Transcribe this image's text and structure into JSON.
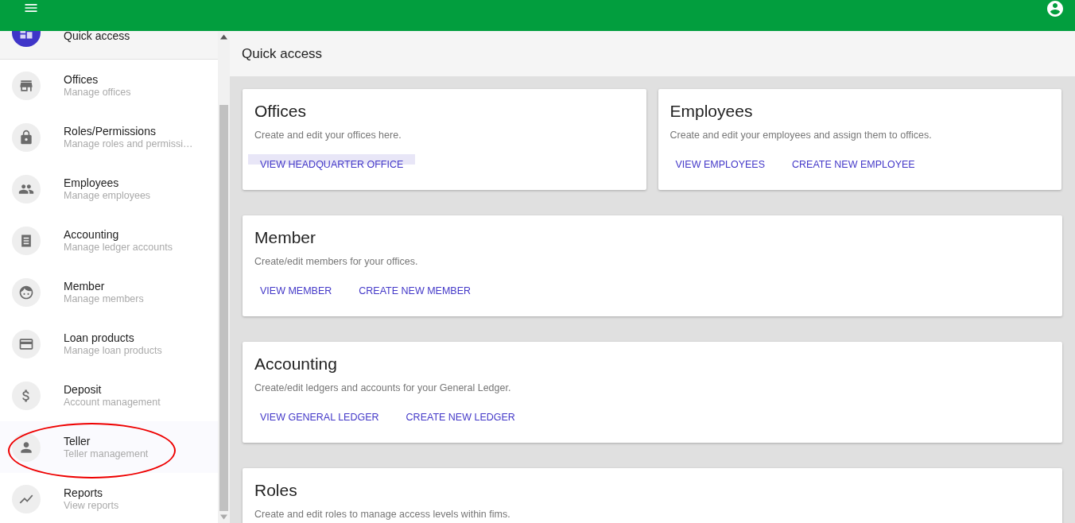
{
  "sidebar": {
    "items": [
      {
        "title": "Quick access",
        "selected": true,
        "circled": false
      },
      {
        "title": "Offices",
        "subtitle": "Manage offices",
        "selected": false,
        "circled": false
      },
      {
        "title": "Roles/Permissions",
        "subtitle": "Manage roles and permissi…",
        "selected": false,
        "circled": false
      },
      {
        "title": "Employees",
        "subtitle": "Manage employees",
        "selected": false,
        "circled": false
      },
      {
        "title": "Accounting",
        "subtitle": "Manage ledger accounts",
        "selected": false,
        "circled": false
      },
      {
        "title": "Member",
        "subtitle": "Manage members",
        "selected": false,
        "circled": false
      },
      {
        "title": "Loan products",
        "subtitle": "Manage loan products",
        "selected": false,
        "circled": false
      },
      {
        "title": "Deposit",
        "subtitle": "Account management",
        "selected": false,
        "circled": false
      },
      {
        "title": "Teller",
        "subtitle": "Teller management",
        "selected": false,
        "circled": true
      },
      {
        "title": "Reports",
        "subtitle": "View reports",
        "selected": false,
        "circled": false
      }
    ]
  },
  "page_title": "Quick access",
  "cards": [
    {
      "title": "Offices",
      "description": "Create and edit your offices here.",
      "actions": [
        {
          "label": "VIEW HEADQUARTER OFFICE",
          "focused": true
        }
      ]
    },
    {
      "title": "Employees",
      "description": "Create and edit your employees and assign them to offices.",
      "actions": [
        {
          "label": "VIEW EMPLOYEES",
          "focused": false
        },
        {
          "label": "CREATE NEW EMPLOYEE",
          "focused": false
        }
      ]
    },
    {
      "title": "Member",
      "description": "Create/edit members for your offices.",
      "actions": [
        {
          "label": "VIEW MEMBER",
          "focused": false
        },
        {
          "label": "CREATE NEW MEMBER",
          "focused": false
        }
      ]
    },
    {
      "title": "Accounting",
      "description": "Create/edit ledgers and accounts for your General Ledger.",
      "actions": [
        {
          "label": "VIEW GENERAL LEDGER",
          "focused": false
        },
        {
          "label": "CREATE NEW LEDGER",
          "focused": false
        }
      ]
    },
    {
      "title": "Roles",
      "description": "Create and edit roles to manage access levels within fims."
    }
  ]
}
